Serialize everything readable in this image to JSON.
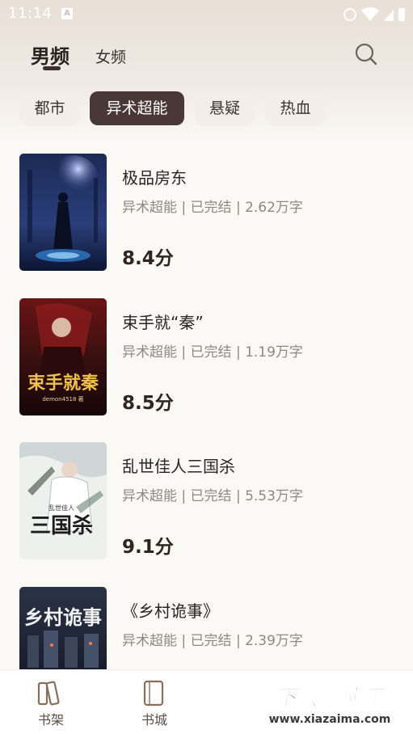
{
  "status_bar": {
    "time": "11:14",
    "notif_badge": "A"
  },
  "top_tabs": {
    "male": "男频",
    "female": "女频"
  },
  "categories": [
    {
      "label": "都市",
      "active": false
    },
    {
      "label": "异术超能",
      "active": true
    },
    {
      "label": "悬疑",
      "active": false
    },
    {
      "label": "热血",
      "active": false
    }
  ],
  "books": [
    {
      "title": "极品房东",
      "meta": "异术超能 | 已完结 | 2.62万字",
      "score": "8.4分"
    },
    {
      "title": "束手就“秦”",
      "meta": "异术超能 | 已完结 | 1.19万字",
      "score": "8.5分",
      "cover_text": "束手就秦",
      "cover_small": "demon4518 著"
    },
    {
      "title": "乱世佳人三国杀",
      "meta": "异术超能 | 已完结 | 5.53万字",
      "score": "9.1分",
      "cover_text": "三国杀",
      "cover_small": "乱世佳人"
    },
    {
      "title": "《乡村诡事》",
      "meta": "异术超能 | 已完结 | 2.39万字",
      "score": "",
      "cover_text": "乡村诡事"
    }
  ],
  "bottom_nav": {
    "shelf": "书架",
    "store": "书城"
  },
  "watermark": {
    "brand": "下载吗应用",
    "url": "www.xiazaima.com"
  },
  "colors": {
    "accent": "#4a3836",
    "chip_bg": "#f4eee8",
    "meta": "#8e8884"
  },
  "icons": {
    "search": "search-icon",
    "shelf": "bookshelf-icon",
    "store": "book-icon"
  }
}
